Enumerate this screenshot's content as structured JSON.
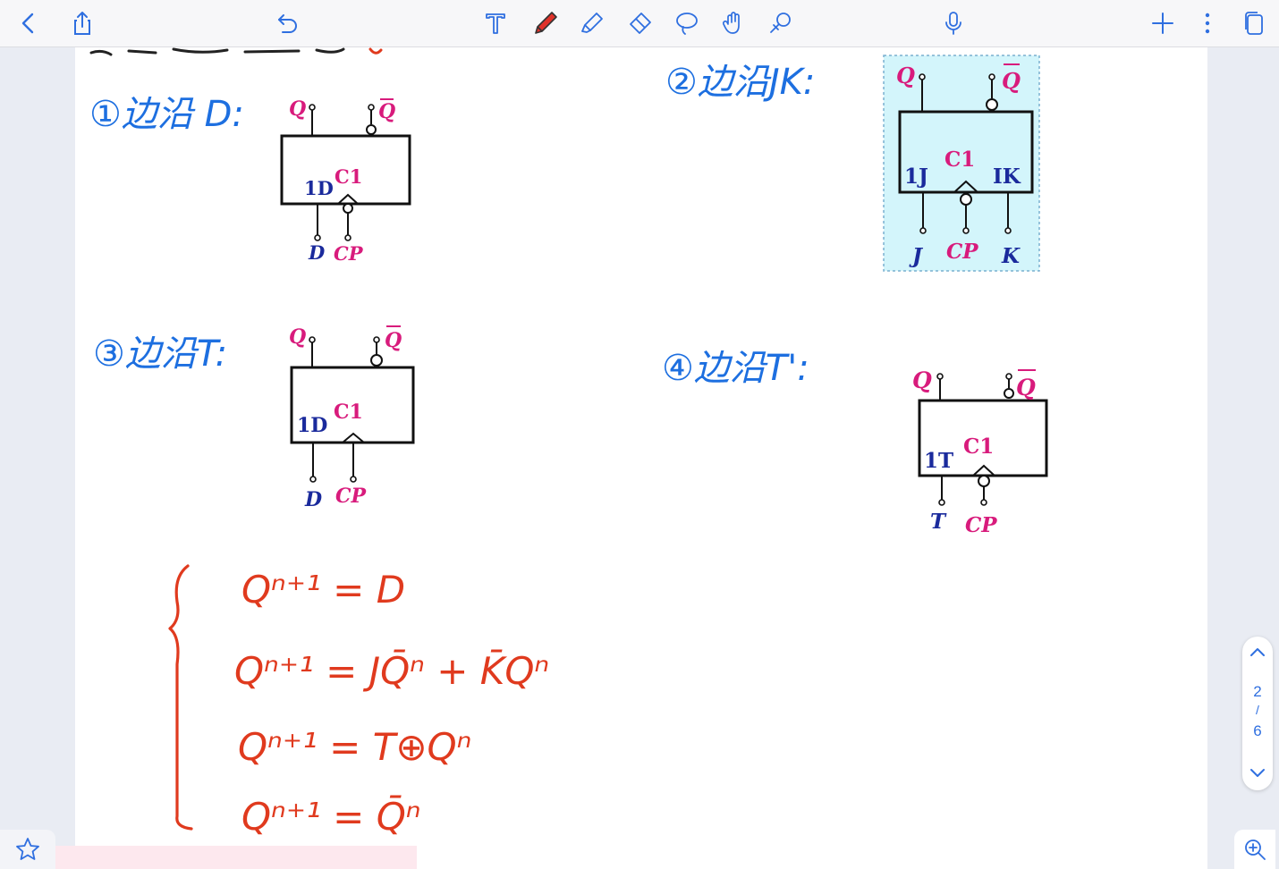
{
  "toolbar": {
    "left_icons": [
      "back-chevron-icon",
      "share-icon",
      "undo-icon"
    ],
    "center_tools": [
      "text-tool-icon",
      "pen-tool-icon",
      "highlighter-tool-icon",
      "eraser-tool-icon",
      "lasso-tool-icon",
      "hand-tool-icon",
      "laser-pointer-icon"
    ],
    "right_icons": [
      "microphone-icon",
      "add-page-icon",
      "more-options-icon",
      "pages-icon"
    ],
    "accent_color": "#2f6fe0",
    "pen_color": "#e0322a"
  },
  "notes": {
    "heading_1": "①边沿 D:",
    "heading_2": "②边沿JK:",
    "heading_3": "③边沿T:",
    "heading_4": "④边沿T':",
    "eq_1": "Qⁿ⁺¹ = D",
    "eq_2": "Qⁿ⁺¹ = JQ̄ⁿ + K̄Qⁿ",
    "eq_3": "Qⁿ⁺¹ = T⊕Qⁿ",
    "eq_4": "Qⁿ⁺¹ = Q̄ⁿ",
    "ink_blue": "#1d6fe0",
    "ink_red": "#e03a1e"
  },
  "symbols": {
    "d_ff": {
      "out_q": "Q",
      "out_qbar": "Q",
      "in_label": "1D",
      "clk_label": "C1",
      "pin_1": "D",
      "pin_2": "CP"
    },
    "jk_ff": {
      "out_q": "Q",
      "out_qbar": "Q",
      "in_label_1": "1J",
      "clk_label": "C1",
      "in_label_2": "IK",
      "pin_1": "J",
      "pin_2": "CP",
      "pin_3": "K",
      "highlight": "#d3f5fb"
    },
    "t_ff": {
      "out_q": "Q",
      "out_qbar": "Q",
      "in_label": "1D",
      "clk_label": "C1",
      "pin_1": "D",
      "pin_2": "CP"
    },
    "tp_ff": {
      "out_q": "Q",
      "out_qbar": "Q",
      "in_label": "1T",
      "clk_label": "C1",
      "pin_1": "T",
      "pin_2": "CP"
    },
    "label_pink": "#d81b7c",
    "label_navy": "#1a2a9c"
  },
  "pager": {
    "current": "2",
    "separator": "/",
    "total": "6"
  }
}
